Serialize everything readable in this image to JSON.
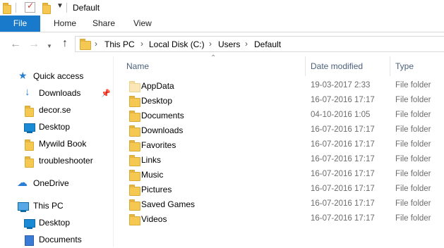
{
  "window": {
    "title": "Default"
  },
  "ribbon": {
    "file_label": "File",
    "tabs": [
      "Home",
      "Share",
      "View"
    ]
  },
  "address": {
    "crumbs": [
      "This PC",
      "Local Disk (C:)",
      "Users",
      "Default"
    ],
    "back_icon": "arrow-left-icon",
    "forward_icon": "arrow-right-icon",
    "recent_icon": "chevron-down-icon",
    "up_icon": "arrow-up-icon"
  },
  "nav": {
    "quick_access": "Quick access",
    "quick_items": [
      {
        "label": "Downloads",
        "icon": "download-arrow-icon",
        "pinned": true
      },
      {
        "label": "decor.se",
        "icon": "folder-icon"
      },
      {
        "label": "Desktop",
        "icon": "desktop-icon"
      },
      {
        "label": "Mywild Book",
        "icon": "folder-icon"
      },
      {
        "label": "troubleshooter",
        "icon": "folder-icon"
      }
    ],
    "onedrive": "OneDrive",
    "this_pc": "This PC",
    "pc_items": [
      {
        "label": "Desktop",
        "icon": "desktop-icon"
      },
      {
        "label": "Documents",
        "icon": "documents-icon"
      }
    ]
  },
  "columns": {
    "name": "Name",
    "date": "Date modified",
    "type": "Type"
  },
  "files": [
    {
      "name": "AppData",
      "date": "19-03-2017 2:33",
      "type": "File folder",
      "hidden": true
    },
    {
      "name": "Desktop",
      "date": "16-07-2016 17:17",
      "type": "File folder"
    },
    {
      "name": "Documents",
      "date": "04-10-2016 1:05",
      "type": "File folder"
    },
    {
      "name": "Downloads",
      "date": "16-07-2016 17:17",
      "type": "File folder"
    },
    {
      "name": "Favorites",
      "date": "16-07-2016 17:17",
      "type": "File folder"
    },
    {
      "name": "Links",
      "date": "16-07-2016 17:17",
      "type": "File folder"
    },
    {
      "name": "Music",
      "date": "16-07-2016 17:17",
      "type": "File folder"
    },
    {
      "name": "Pictures",
      "date": "16-07-2016 17:17",
      "type": "File folder"
    },
    {
      "name": "Saved Games",
      "date": "16-07-2016 17:17",
      "type": "File folder"
    },
    {
      "name": "Videos",
      "date": "16-07-2016 17:17",
      "type": "File folder"
    }
  ],
  "colors": {
    "accent": "#1979ca",
    "folder": "#f5c851"
  }
}
